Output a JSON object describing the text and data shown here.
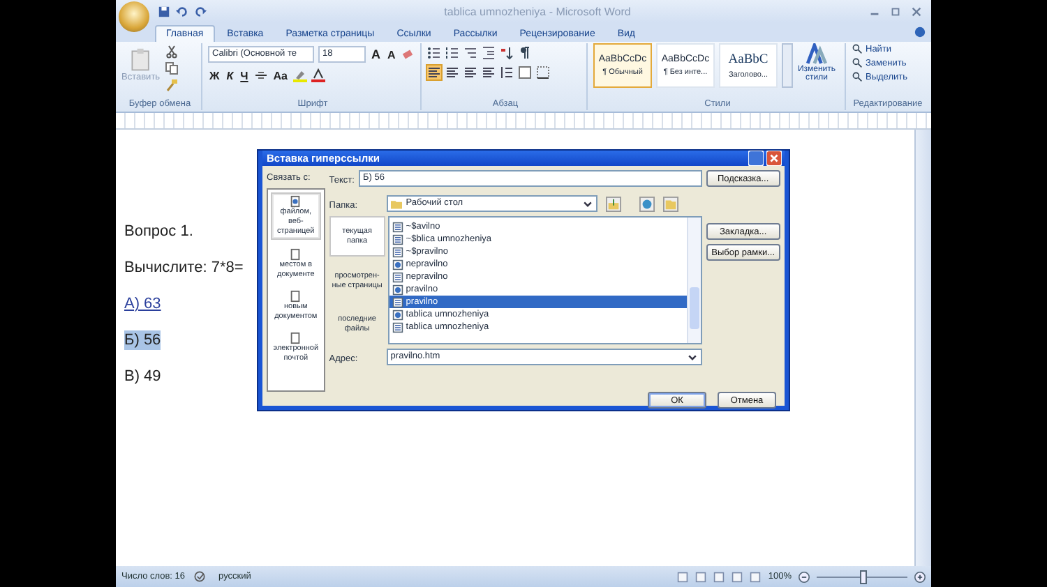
{
  "window": {
    "title": "tablica umnozheniya - Microsoft Word"
  },
  "tabs": [
    {
      "label": "Главная",
      "selected": true
    },
    {
      "label": "Вставка",
      "selected": false
    },
    {
      "label": "Разметка страницы",
      "selected": false
    },
    {
      "label": "Ссылки",
      "selected": false
    },
    {
      "label": "Рассылки",
      "selected": false
    },
    {
      "label": "Рецензирование",
      "selected": false
    },
    {
      "label": "Вид",
      "selected": false
    }
  ],
  "ribbon": {
    "clipboard": {
      "paste": "Вставить",
      "label": "Буфер обмена"
    },
    "font": {
      "name": "Calibri (Основной те",
      "size": "18",
      "format_buttons": [
        "Ж",
        "К",
        "Ч"
      ],
      "grow": "A",
      "shrink": "A",
      "case": "Aa",
      "label": "Шрифт"
    },
    "paragraph": {
      "alignment": [
        {
          "selected": true
        },
        {
          "selected": false
        },
        {
          "selected": false
        },
        {
          "selected": false
        }
      ],
      "label": "Абзац"
    },
    "styles": {
      "items": [
        {
          "preview": "AaBbCcDc",
          "name": "¶ Обычный",
          "selected": true
        },
        {
          "preview": "AaBbCcDc",
          "name": "¶ Без инте...",
          "selected": false
        },
        {
          "preview": "AaBbC",
          "name": "Заголово...",
          "selected": false
        }
      ],
      "change": "Изменить стили",
      "label": "Стили"
    },
    "editing": {
      "items": [
        "Найти",
        "Заменить",
        "Выделить"
      ],
      "label": "Редактирование"
    }
  },
  "document": {
    "paragraphs": [
      {
        "text": "Вопрос 1.",
        "kind": "plain"
      },
      {
        "text": "Вычислите: 7*8=",
        "kind": "plain"
      },
      {
        "text": "А) 63",
        "kind": "link"
      },
      {
        "text": "Б) 56",
        "kind": "highlight"
      },
      {
        "text": "В) 49",
        "kind": "plain"
      }
    ]
  },
  "dialog": {
    "title": "Вставка гиперссылки",
    "link_with": "Связать с:",
    "text_label": "Текст:",
    "text_value": "Б) 56",
    "screen_tip": "Подсказка...",
    "link_types": [
      {
        "label": "файлом, веб-страницей",
        "selected": true
      },
      {
        "label": "местом в документе",
        "selected": false
      },
      {
        "label": "новым документом",
        "selected": false
      },
      {
        "label": "электронной почтой",
        "selected": false
      }
    ],
    "folder_label": "Папка:",
    "folder": "Рабочий стол",
    "browse": [
      {
        "label": "текущая папка",
        "selected": true
      },
      {
        "label": "просмотрен-ные страницы",
        "selected": false
      },
      {
        "label": "последние файлы",
        "selected": false
      }
    ],
    "files": [
      {
        "name": "~$avilno",
        "kind": "doc",
        "selected": false
      },
      {
        "name": "~$blica umnozheniya",
        "kind": "doc",
        "selected": false
      },
      {
        "name": "~$pravilno",
        "kind": "doc",
        "selected": false
      },
      {
        "name": "nepravilno",
        "kind": "web",
        "selected": false
      },
      {
        "name": "nepravilno",
        "kind": "doc",
        "selected": false
      },
      {
        "name": "pravilno",
        "kind": "web",
        "selected": false
      },
      {
        "name": "pravilno",
        "kind": "doc",
        "selected": true
      },
      {
        "name": "tablica umnozheniya",
        "kind": "web",
        "selected": false
      },
      {
        "name": "tablica umnozheniya",
        "kind": "doc",
        "selected": false
      }
    ],
    "address_label": "Адрес:",
    "address": "pravilno.htm",
    "side_buttons": [
      "Закладка...",
      "Выбор рамки..."
    ],
    "ok": "ОК",
    "cancel": "Отмена"
  },
  "status_bar": {
    "word_count": "Число слов: 16",
    "language": "русский",
    "zoom": "100%",
    "zoom_level": {
      "level": 0.5
    }
  }
}
